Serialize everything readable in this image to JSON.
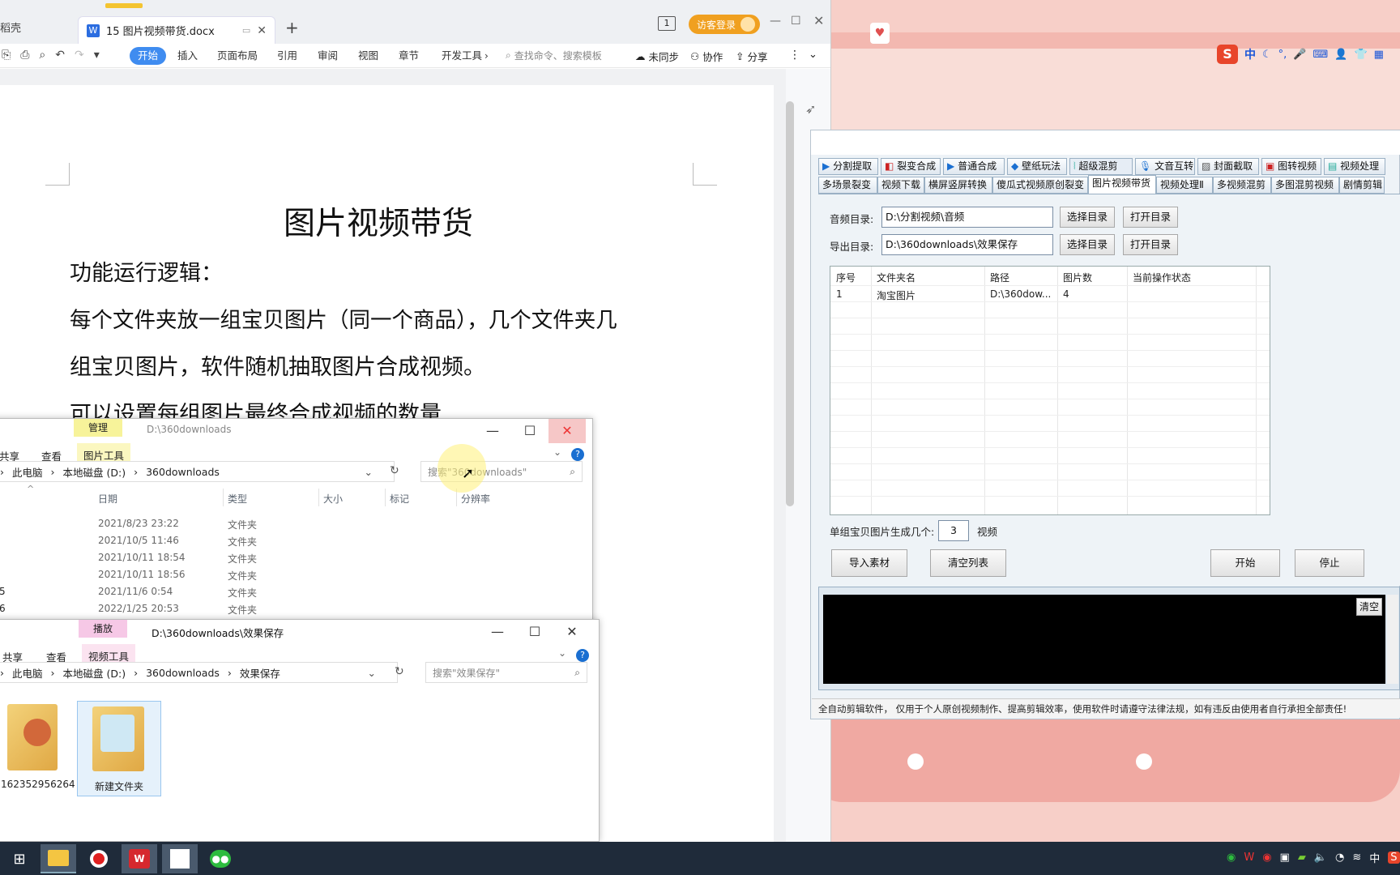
{
  "wps": {
    "tab_left_partial": "稻壳",
    "doc_tab": "15 图片视频带货.docx",
    "page_badge": "1",
    "guest_login": "访客登录",
    "ribbon": [
      "开始",
      "插入",
      "页面布局",
      "引用",
      "审阅",
      "视图",
      "章节",
      "开发工具"
    ],
    "search_placeholder": "查找命令、搜索模板",
    "sync": "未同步",
    "collab": "协作",
    "share": "分享",
    "doc": {
      "title": "图片视频带货",
      "line1": "功能运行逻辑：",
      "line2": "每个文件夹放一组宝贝图片（同一个商品），几个文件夹几",
      "line3": "组宝贝图片，软件随机抽取图片合成视频。",
      "line4": "可以设置每组图片最终合成视频的数量"
    }
  },
  "explorer1": {
    "context_tab": "管理",
    "title": "D:\\360downloads",
    "ribbon": [
      "共享",
      "查看",
      "图片工具"
    ],
    "breadcrumb": [
      "此电脑",
      "本地磁盘 (D:)",
      "360downloads"
    ],
    "search_placeholder": "搜索\"360downloads\"",
    "columns": [
      "日期",
      "类型",
      "大小",
      "标记",
      "分辨率"
    ],
    "rows": [
      {
        "name": "",
        "date": "2021/8/23 23:22",
        "type": "文件夹"
      },
      {
        "name": "",
        "date": "2021/10/5 11:46",
        "type": "文件夹"
      },
      {
        "name": "",
        "date": "2021/10/11 18:54",
        "type": "文件夹"
      },
      {
        "name": "",
        "date": "2021/10/11 18:56",
        "type": "文件夹"
      },
      {
        "name": "5",
        "date": "2021/11/6 0:54",
        "type": "文件夹"
      },
      {
        "name": "6",
        "date": "2022/1/25 20:53",
        "type": "文件夹"
      }
    ]
  },
  "explorer2": {
    "context_tab": "播放",
    "title": "D:\\360downloads\\效果保存",
    "ribbon": [
      "共享",
      "查看",
      "视频工具"
    ],
    "breadcrumb": [
      "此电脑",
      "本地磁盘 (D:)",
      "360downloads",
      "效果保存"
    ],
    "search_placeholder": "搜索\"效果保存\"",
    "items": [
      {
        "name": "162352956264"
      },
      {
        "name": "新建文件夹"
      }
    ]
  },
  "tool": {
    "tabs_row1": [
      "分割提取",
      "裂变合成",
      "普通合成",
      "壁纸玩法",
      "超级混剪",
      "文音互转",
      "封面截取",
      "图转视频",
      "视频处理"
    ],
    "tabs_row2": [
      "多场景裂变",
      "视频下载",
      "横屏竖屏转换",
      "傻瓜式视频原创裂变",
      "图片视频带货",
      "视频处理Ⅱ",
      "多视频混剪",
      "多图混剪视频",
      "剧情剪辑"
    ],
    "audio_label": "音频目录:",
    "audio_value": "D:\\分割视频\\音频",
    "export_label": "导出目录:",
    "export_value": "D:\\360downloads\\效果保存",
    "select_dir": "选择目录",
    "open_dir": "打开目录",
    "grid_headers": [
      "序号",
      "文件夹名",
      "路径",
      "图片数",
      "当前操作状态"
    ],
    "grid_rows": [
      {
        "idx": "1",
        "folder": "淘宝图片",
        "path": "D:\\360dow...",
        "count": "4",
        "status": ""
      }
    ],
    "gen_label": "单组宝贝图片生成几个:",
    "gen_value": "3",
    "gen_unit": "视频",
    "btn_import": "导入素材",
    "btn_clear_list": "清空列表",
    "btn_start": "开始",
    "btn_stop": "停止",
    "btn_clear": "清空",
    "footer": "全自动剪辑软件， 仅用于个人原创视频制作、提高剪辑效率，使用软件时请遵守法律法规，如有违反由使用者自行承担全部责任!"
  },
  "ime": {
    "lang": "中"
  },
  "tray": {
    "lang": "中"
  }
}
